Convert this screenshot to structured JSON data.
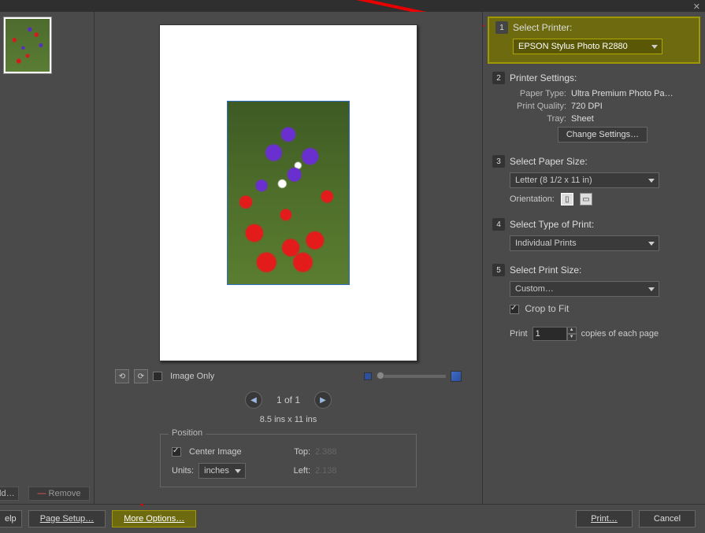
{
  "titlebar": {
    "close": "✕"
  },
  "thumbnails": {
    "add": "dd…",
    "remove": "Remove"
  },
  "preview": {
    "imageOnlyLabel": "Image Only",
    "pageIndicator": "1 of 1",
    "pageDims": "8.5 ins x 11 ins"
  },
  "position": {
    "legend": "Position",
    "centerLabel": "Center Image",
    "centerChecked": true,
    "unitsLabel": "Units:",
    "unitsValue": "inches",
    "topLabel": "Top:",
    "topValue": "2.388",
    "leftLabel": "Left:",
    "leftValue": "2.138"
  },
  "right": {
    "step1": {
      "num": "1",
      "title": "Select Printer:",
      "value": "EPSON Stylus Photo R2880"
    },
    "step2": {
      "num": "2",
      "title": "Printer Settings:",
      "paperTypeLabel": "Paper Type:",
      "paperTypeValue": "Ultra Premium Photo Pa…",
      "qualityLabel": "Print Quality:",
      "qualityValue": "720 DPI",
      "trayLabel": "Tray:",
      "trayValue": "Sheet",
      "changeBtn": "Change Settings…"
    },
    "step3": {
      "num": "3",
      "title": "Select Paper Size:",
      "value": "Letter (8 1/2 x 11 in)",
      "orientLabel": "Orientation:"
    },
    "step4": {
      "num": "4",
      "title": "Select Type of Print:",
      "value": "Individual Prints"
    },
    "step5": {
      "num": "5",
      "title": "Select Print Size:",
      "value": "Custom…",
      "cropLabel": "Crop to Fit",
      "cropChecked": true
    },
    "copies": {
      "printLabel": "Print",
      "value": "1",
      "suffix": "copies of each page"
    }
  },
  "bottom": {
    "help": "elp",
    "pageSetup": "Page Setup…",
    "moreOptions": "More Options…",
    "print": "Print…",
    "cancel": "Cancel"
  }
}
